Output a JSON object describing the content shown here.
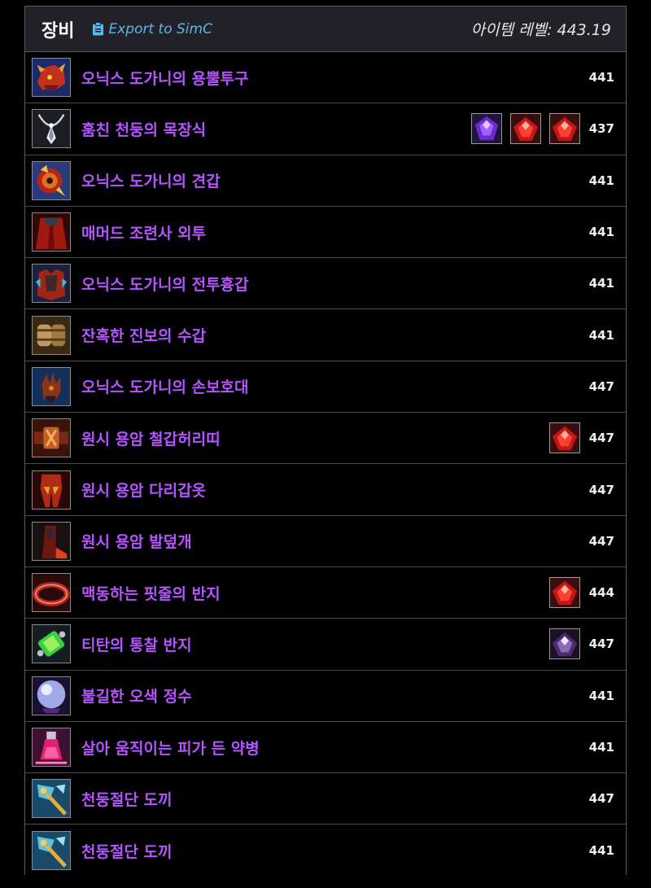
{
  "header": {
    "title": "장비",
    "export_label": "Export to SimC",
    "item_level": "아이템 레벨: 443.19"
  },
  "items": [
    {
      "name": "오닉스 도가니의 용뿔투구",
      "level": "441",
      "icon": "helm-icon",
      "gems": []
    },
    {
      "name": "훔친 천둥의 목장식",
      "level": "437",
      "icon": "necklace-icon",
      "gems": [
        "purple",
        "red",
        "red"
      ]
    },
    {
      "name": "오닉스 도가니의 견갑",
      "level": "441",
      "icon": "shoulder-icon",
      "gems": []
    },
    {
      "name": "매머드 조련사 외투",
      "level": "441",
      "icon": "cloak-icon",
      "gems": []
    },
    {
      "name": "오닉스 도가니의 전투흉갑",
      "level": "441",
      "icon": "chest-icon",
      "gems": []
    },
    {
      "name": "잔혹한 진보의 수갑",
      "level": "441",
      "icon": "bracer-icon",
      "gems": []
    },
    {
      "name": "오닉스 도가니의 손보호대",
      "level": "447",
      "icon": "gloves-icon",
      "gems": []
    },
    {
      "name": "원시 용암 철갑허리띠",
      "level": "447",
      "icon": "belt-icon",
      "gems": [
        "red"
      ]
    },
    {
      "name": "원시 용암 다리갑옷",
      "level": "447",
      "icon": "legs-icon",
      "gems": []
    },
    {
      "name": "원시 용암 발덮개",
      "level": "447",
      "icon": "boots-icon",
      "gems": []
    },
    {
      "name": "맥동하는 핏줄의 반지",
      "level": "444",
      "icon": "ring-icon",
      "gems": [
        "red"
      ]
    },
    {
      "name": "티탄의 통찰 반지",
      "level": "447",
      "icon": "ring-green-icon",
      "gems": [
        "light-purple"
      ]
    },
    {
      "name": "불길한 오색 정수",
      "level": "441",
      "icon": "orb-icon",
      "gems": []
    },
    {
      "name": "살아 움직이는 피가 든 약병",
      "level": "441",
      "icon": "vial-icon",
      "gems": []
    },
    {
      "name": "천둥절단 도끼",
      "level": "447",
      "icon": "axe-icon",
      "gems": []
    },
    {
      "name": "천둥절단 도끼",
      "level": "441",
      "icon": "axe-icon",
      "gems": []
    }
  ],
  "colors": {
    "item_name": "#b455ff",
    "export_link": "#5fb6e6",
    "header_bg": "#222127"
  }
}
